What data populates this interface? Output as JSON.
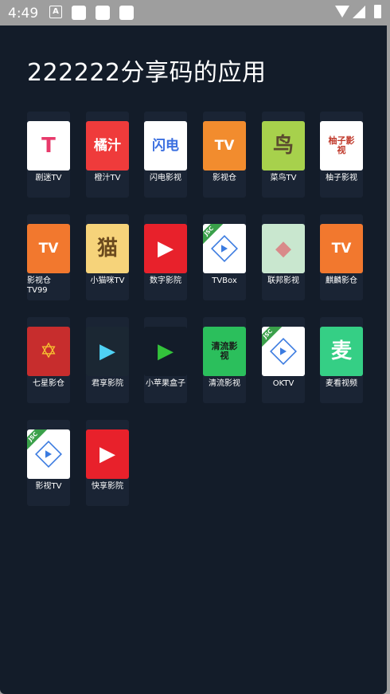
{
  "statusbar": {
    "time": "4:49",
    "a_icon": "A"
  },
  "title": "222222分享码的应用",
  "apps": [
    {
      "label": "剧迷TV",
      "icon": "drama-fan-tv-icon",
      "bg": "#ffffff",
      "glyph": "T",
      "fg": "#e83a6b"
    },
    {
      "label": "橙汁TV",
      "icon": "orange-juice-tv-icon",
      "bg": "#ef3b3b",
      "glyph": "橘汁",
      "fg": "#ffffff"
    },
    {
      "label": "闪电影视",
      "icon": "lightning-video-icon",
      "bg": "#ffffff",
      "glyph": "闪电",
      "fg": "#3b6fe0"
    },
    {
      "label": "影视仓",
      "icon": "tv-warehouse-icon",
      "bg": "#f28c2e",
      "glyph": "TV",
      "fg": "#ffffff"
    },
    {
      "label": "菜鸟TV",
      "icon": "bird-tv-icon",
      "bg": "#a7d14c",
      "glyph": "鸟",
      "fg": "#5a4a2e"
    },
    {
      "label": "柚子影视",
      "icon": "pomelo-video-icon",
      "bg": "#ffffff",
      "glyph": "柚子影视",
      "fg": "#c0392b"
    },
    {
      "label": "影视仓\nTV99",
      "icon": "tv-warehouse-99-icon",
      "bg": "#f2782e",
      "glyph": "TV",
      "fg": "#ffffff"
    },
    {
      "label": "小猫咪TV",
      "icon": "kitten-tv-icon",
      "bg": "#f6d37a",
      "glyph": "猫",
      "fg": "#6b4a1e"
    },
    {
      "label": "数字影院",
      "icon": "digital-cinema-icon",
      "bg": "#e8212b",
      "glyph": "▶",
      "fg": "#ffffff"
    },
    {
      "label": "TVBox",
      "icon": "tvbox-icon",
      "bg": "#ffffff",
      "glyph": "",
      "fg": "#3b7be0"
    },
    {
      "label": "联邦影视",
      "icon": "federal-video-icon",
      "bg": "#c9e7cf",
      "glyph": "◆",
      "fg": "#d98a8a"
    },
    {
      "label": "麒麟影仓",
      "icon": "kylin-video-icon",
      "bg": "#f2782e",
      "glyph": "TV",
      "fg": "#ffffff"
    },
    {
      "label": "七星影仓",
      "icon": "seven-star-video-icon",
      "bg": "#c72d2d",
      "glyph": "✡",
      "fg": "#f7c531"
    },
    {
      "label": "君享影院",
      "icon": "junxiang-cinema-icon",
      "bg": "#1b2733",
      "glyph": "▶",
      "fg": "#4fd1f5"
    },
    {
      "label": "小苹果盒子",
      "icon": "little-apple-box-icon",
      "bg": "#131c29",
      "glyph": "▶",
      "fg": "#33c23b"
    },
    {
      "label": "清流影视",
      "icon": "clear-stream-video-icon",
      "bg": "#2bbf5c",
      "glyph": "清流影视",
      "fg": "#1a1a1a"
    },
    {
      "label": "OKTV",
      "icon": "oktv-icon",
      "bg": "#ffffff",
      "glyph": "",
      "fg": "#3b7be0"
    },
    {
      "label": "麦看视频",
      "icon": "maikan-video-icon",
      "bg": "#35cf85",
      "glyph": "麦",
      "fg": "#ffffff"
    },
    {
      "label": "影视TV",
      "icon": "video-tv-icon",
      "bg": "#ffffff",
      "glyph": "",
      "fg": "#3b7be0"
    },
    {
      "label": "快享影院",
      "icon": "kuaixiang-cinema-icon",
      "bg": "#e8212b",
      "glyph": "▶",
      "fg": "#ffffff"
    }
  ]
}
